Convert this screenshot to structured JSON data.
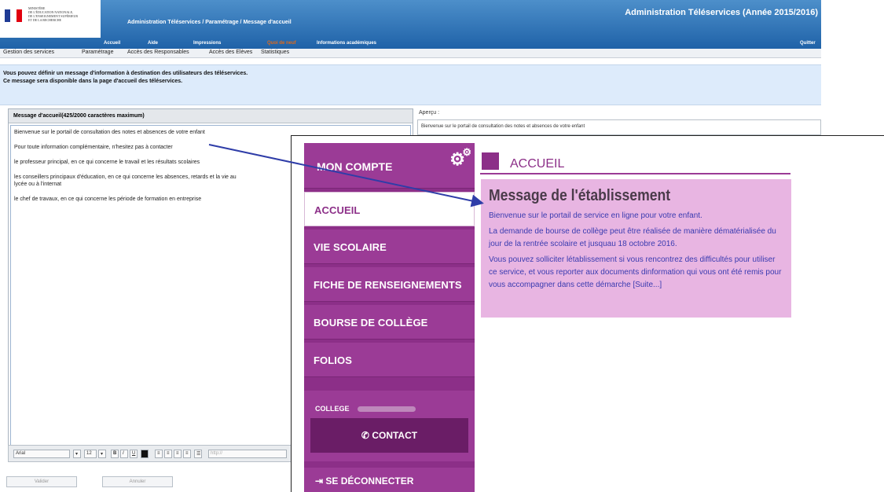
{
  "header": {
    "ministry_lines": "MINISTÈRE\nDE L'ÉDUCATION NATIONALE,\nDE L'ENSEIGNEMENT SUPÉRIEUR\nET DE LA RECHERCHE",
    "app_title": "Administration Téléservices / Paramétrage / Message d'accueil",
    "main_title": "Administration Téléservices (Année 2015/2016)",
    "nav": {
      "accueil": "Accueil",
      "aide": "Aide",
      "impressions": "Impressions",
      "quoi_de_neuf": "Quoi de neuf",
      "infos": "Informations académiques",
      "quitter": "Quitter"
    }
  },
  "submenu": [
    "Gestion des services",
    "Paramétrage",
    "Accès des Responsables",
    "Accès des Elèves",
    "Statistiques"
  ],
  "info": {
    "line1": "Vous pouvez définir un message d'information à destination des utilisateurs des téléservices.",
    "line2": "Ce message sera disponible dans la page d'accueil des téléservices."
  },
  "editor": {
    "title": "Message d'accueil(425/2000 caractères maximum)",
    "paragraphs": [
      "Bienvenue sur le portail de consultation des notes et absences de votre enfant",
      "Pour toute information complémentaire, n'hesitez pas à contacter",
      "le professeur principal, en ce qui concerne le travail et les résultats scolaires",
      "les conseillers principaux d'éducation, en ce qui concerne les absences, retards et la vie au lycée ou à l'internat",
      "le chef de travaux, en ce qui concerne les période de formation en entreprise"
    ],
    "font": "Arial",
    "size": "12",
    "link_placeholder": "http://"
  },
  "apercu": {
    "label": "Aperçu :",
    "text": "Bienvenue sur le portail de consultation des notes et absences de votre enfant"
  },
  "buttons": {
    "valider": "Valider",
    "annuler": "Annuler"
  },
  "ent": {
    "mon_compte": "MON COMPTE",
    "menu": [
      "ACCUEIL",
      "VIE SCOLAIRE",
      "FICHE DE RENSEIGNEMENTS",
      "BOURSE DE COLLÈGE",
      "FOLIOS"
    ],
    "college_label": "COLLEGE",
    "contact": "CONTACT",
    "logout": "SE DÉCONNECTER",
    "accueil_title": "ACCUEIL",
    "message_title": "Message de l'établissement",
    "message_paragraphs": [
      "Bienvenue sur le portail de service en ligne pour votre enfant.",
      "La demande de bourse de collège peut être réalisée de manière dématérialisée du jour de la rentrée scolaire et jusquau 18 octobre 2016.",
      "Vous pouvez solliciter létablissement si vous rencontrez des difficultés pour utiliser ce service, et vous reporter aux documents dinformation qui vous ont été remis pour vous accompagner dans cette démarche [Suite...]"
    ],
    "colors": {
      "purple": "#8c2f88",
      "pink_box": "#e8b5e2",
      "link_text": "#3a3bb0"
    }
  }
}
